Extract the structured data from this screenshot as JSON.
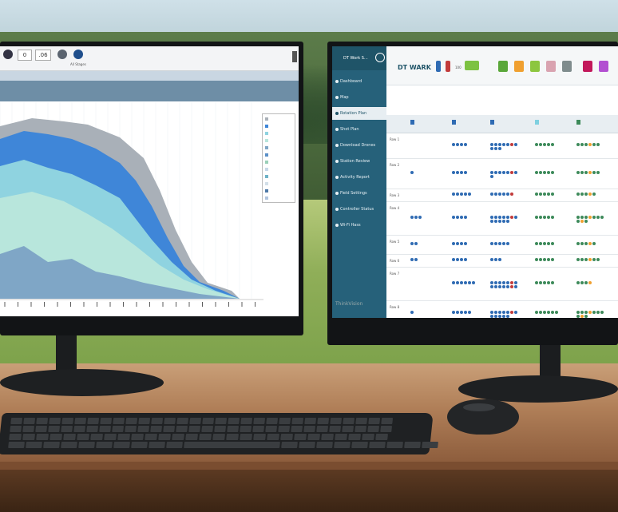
{
  "left_screen": {
    "toolbar": {
      "field_1": "0",
      "field_2": ".06",
      "labels": [
        "All Stages"
      ]
    },
    "legend_items": [
      "",
      "",
      "",
      "",
      "",
      "",
      "",
      "",
      "",
      "",
      "",
      ""
    ]
  },
  "right_screen": {
    "app_title": "DT Work S...",
    "header": {
      "mark": "DT WARK",
      "stat_label": "100"
    },
    "sidebar": {
      "items": [
        "Dashboard",
        "Map",
        "Rotation Plan",
        "Shot Plan",
        "Download Drones",
        "Station Review",
        "Activity Report",
        "Field Settings",
        "Controller Status",
        "Wi-Fi Hass"
      ]
    },
    "rows": [
      "Row 1",
      "Row 2",
      "Row 3",
      "Row 4",
      "Row 5",
      "Row 6",
      "Row 7",
      "Row 8"
    ],
    "brand": "ThinkVision"
  },
  "colors": {
    "sidebar": "#26617a",
    "dot_blue": "#2f6bb3",
    "dot_green": "#3d8a5a",
    "chart_blue": "#3f86d8",
    "chart_cyan": "#8fd3e0",
    "chart_gray": "#9aa4ad"
  }
}
